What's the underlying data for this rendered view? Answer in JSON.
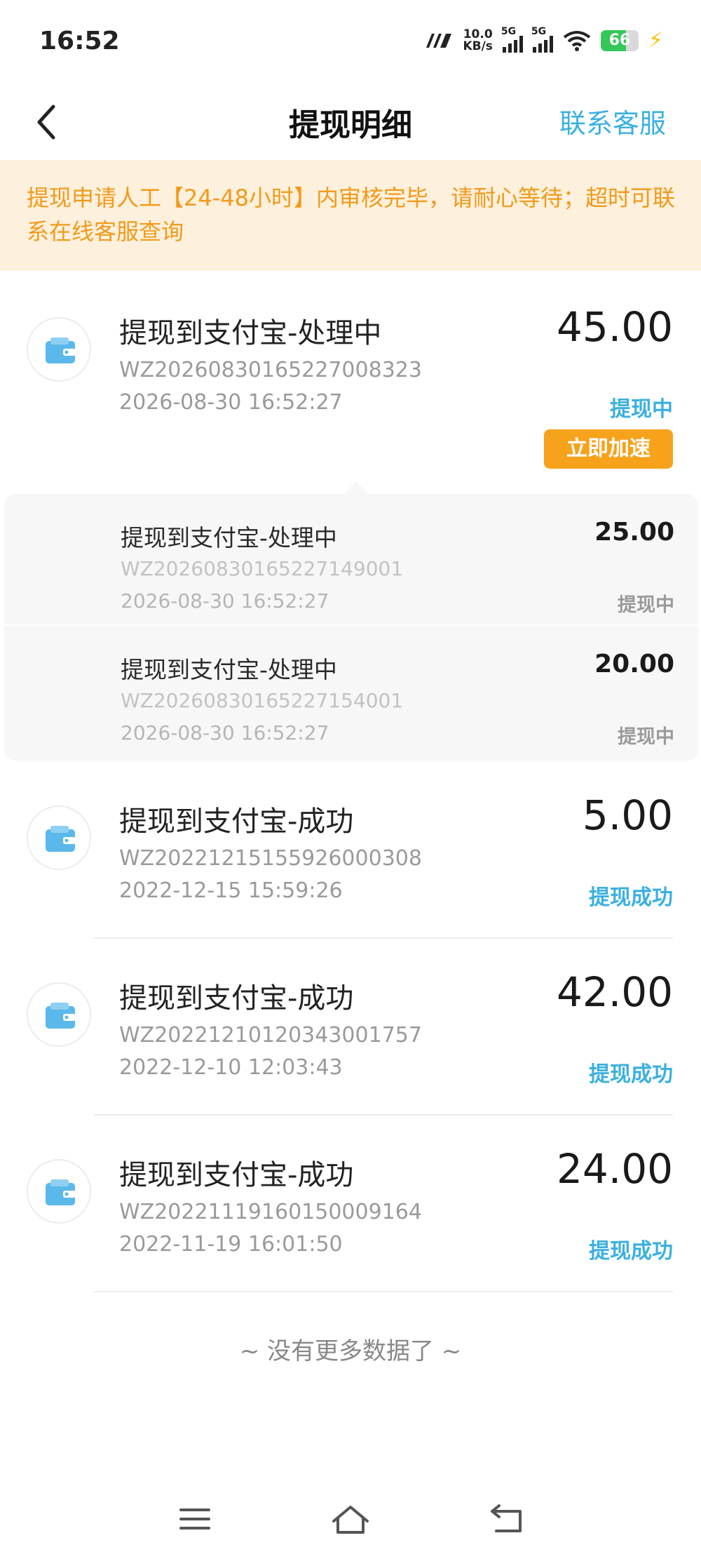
{
  "status_bar": {
    "time": "16:52",
    "net_speed_value": "10.0",
    "net_speed_unit": "KB/s",
    "signal1_label": "5G",
    "signal2_label": "5G",
    "battery_level": "66",
    "battery_fraction": 0.66
  },
  "header": {
    "title": "提现明细",
    "contact_label": "联系客服"
  },
  "notice": {
    "text": "提现申请人工【24-48小时】内审核完毕，请耐心等待；超时可联系在线客服查询"
  },
  "records": [
    {
      "title": "提现到支付宝-处理中",
      "order_no": "WZ20260830165227008323",
      "time": "2026-08-30 16:52:27",
      "amount": "45.00",
      "status": "提现中",
      "action_label": "立即加速",
      "sub_items": [
        {
          "title": "提现到支付宝-处理中",
          "order_no": "WZ20260830165227149001",
          "time": "2026-08-30 16:52:27",
          "amount": "25.00",
          "status": "提现中"
        },
        {
          "title": "提现到支付宝-处理中",
          "order_no": "WZ20260830165227154001",
          "time": "2026-08-30 16:52:27",
          "amount": "20.00",
          "status": "提现中"
        }
      ]
    },
    {
      "title": "提现到支付宝-成功",
      "order_no": "WZ20221215155926000308",
      "time": "2022-12-15 15:59:26",
      "amount": "5.00",
      "status": "提现成功"
    },
    {
      "title": "提现到支付宝-成功",
      "order_no": "WZ20221210120343001757",
      "time": "2022-12-10 12:03:43",
      "amount": "42.00",
      "status": "提现成功"
    },
    {
      "title": "提现到支付宝-成功",
      "order_no": "WZ20221119160150009164",
      "time": "2022-11-19 16:01:50",
      "amount": "24.00",
      "status": "提现成功"
    }
  ],
  "footer": {
    "no_more_text": "~ 没有更多数据了 ~"
  },
  "colors": {
    "accent": "#3bb0e0",
    "notice_bg": "#fdf0dc",
    "notice_text": "#f29a1a",
    "speed_button": "#f7a21b"
  },
  "icons": {
    "back": "chevron-left-icon",
    "wallet": "wallet-icon",
    "menu": "menu-icon",
    "home": "home-icon",
    "return": "back-icon"
  }
}
